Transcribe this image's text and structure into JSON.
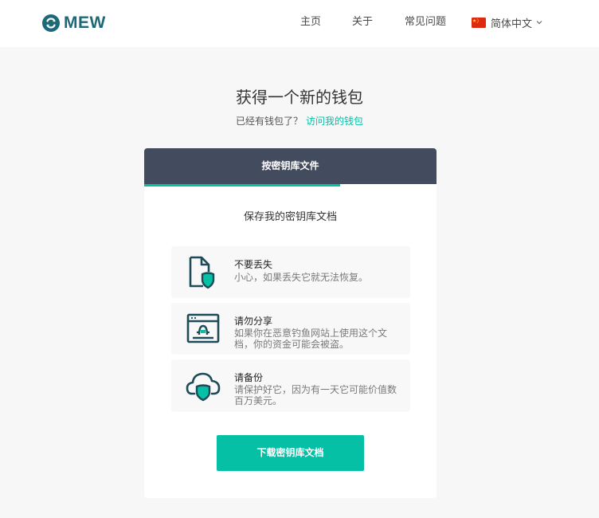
{
  "header": {
    "logo_text": "MEW",
    "nav": {
      "home": "主页",
      "about": "关于",
      "faq": "常见问题"
    },
    "language": {
      "label": "简体中文",
      "flag_icon": "china-flag-icon",
      "chevron_icon": "chevron-down-icon"
    }
  },
  "main": {
    "title": "获得一个新的钱包",
    "subtitle_prefix": "已经有钱包了？",
    "subtitle_link": "访问我的钱包"
  },
  "card": {
    "tab_label": "按密钥库文件",
    "progress_fraction": 0.67,
    "section_title": "保存我的密钥库文档",
    "warnings": [
      {
        "icon": "file-shield-icon",
        "title": "不要丢失",
        "desc": "小心，如果丢失它就无法恢复。"
      },
      {
        "icon": "phishing-browser-icon",
        "title": "请勿分享",
        "desc": "如果你在恶意钓鱼网站上使用这个文档，你的资金可能会被盗。"
      },
      {
        "icon": "cloud-shield-icon",
        "title": "请备份",
        "desc": "请保护好它，因为有一天它可能价值数百万美元。"
      }
    ],
    "download_label": "下载密钥库文档"
  },
  "colors": {
    "accent": "#05c0a5",
    "brand": "#1c6978",
    "tab_bg": "#434c5e",
    "icon_dark": "#1d4b57",
    "page_bg": "#f7f7f7"
  }
}
